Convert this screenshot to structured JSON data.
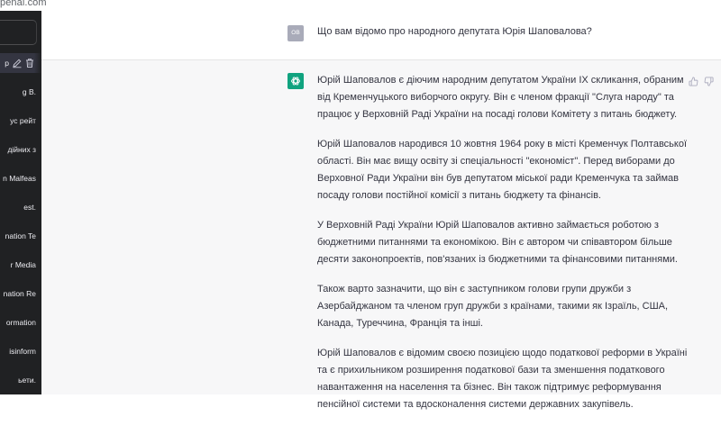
{
  "browser": {
    "url": "penai.com"
  },
  "sidebar": {
    "items": [
      {
        "label": "g B."
      },
      {
        "label": "ус рейт"
      },
      {
        "label": "дійних з"
      },
      {
        "label": "n Malfeas"
      },
      {
        "label": "est."
      },
      {
        "label": "nation Te"
      },
      {
        "label": "r Media"
      },
      {
        "label": "nation Re"
      },
      {
        "label": "ormation"
      },
      {
        "label": "isinform"
      },
      {
        "label": "ьети."
      }
    ],
    "active_label": "p"
  },
  "conversation": {
    "user_avatar": "OB",
    "user_message": "Що вам відомо про народного депутата Юрія Шаповалова?",
    "assistant_paragraphs": [
      "Юрій Шаповалов є діючим народним депутатом України IX скликання, обраним від Кременчуцького виборчого округу. Він є членом фракції \"Слуга народу\" та працює у Верховній Раді України на посаді голови Комітету з питань бюджету.",
      "Юрій Шаповалов народився 10 жовтня 1964 року в місті Кременчук Полтавської області. Він має вищу освіту зі спеціальності \"економіст\". Перед виборами до Верховної Ради України він був депутатом міської ради Кременчука та займав посаду голови постійної комісії з питань бюджету та фінансів.",
      "У Верховній Раді України Юрій Шаповалов активно займається роботою з бюджетними питаннями та економікою. Він є автором чи співавтором більше десяти законопроектів, пов'язаних із бюджетними та фінансовими питаннями.",
      "Також варто зазначити, що він є заступником голови групи дружби з Азербайджаном та членом груп дружби з країнами, такими як Ізраїль, США, Канада, Туреччина, Франція та інші.",
      "Юрій Шаповалов є відомим своєю позицією щодо податкової реформи в Україні та є прихильником розширення податкової бази та зменшення податкового навантаження на населення та бізнес. Він також підтримує реформування пенсійної системи та вдосконалення системи державних закупівель."
    ]
  },
  "icons": {
    "edit": "pencil-icon",
    "delete": "trash-icon",
    "like": "thumbs-up-icon",
    "dislike": "thumbs-down-icon",
    "assistant_logo": "openai-logo-icon"
  },
  "colors": {
    "sidebar_bg": "#202123",
    "assistant_bg": "#f7f7f8",
    "brand": "#10a37f",
    "text": "#343541"
  }
}
